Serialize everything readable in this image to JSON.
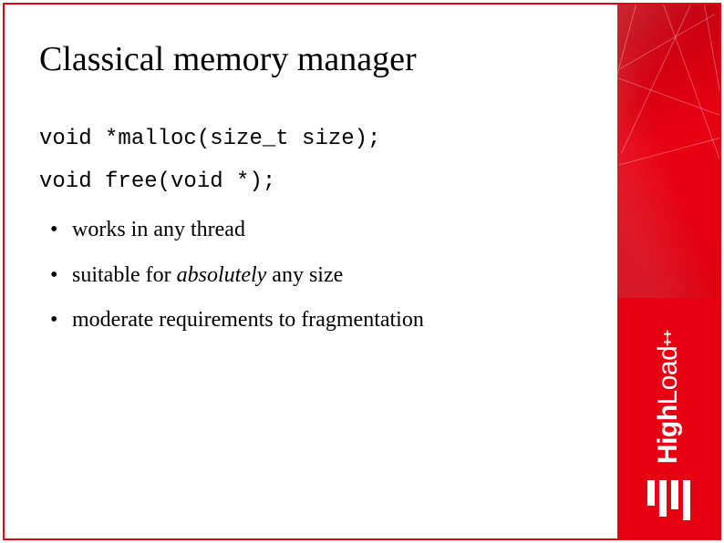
{
  "slide": {
    "title": "Classical memory manager",
    "code_line_1": "void *malloc(size_t size);",
    "code_line_2": "void free(void *);",
    "bullets": {
      "b1": "works in any thread",
      "b2_pre": "suitable for ",
      "b2_em": "absolutely",
      "b2_post": " any size",
      "b3": "moderate requirements to fragmentation"
    }
  },
  "brand": {
    "part1": "High",
    "part2": "Load",
    "plus": "++"
  }
}
